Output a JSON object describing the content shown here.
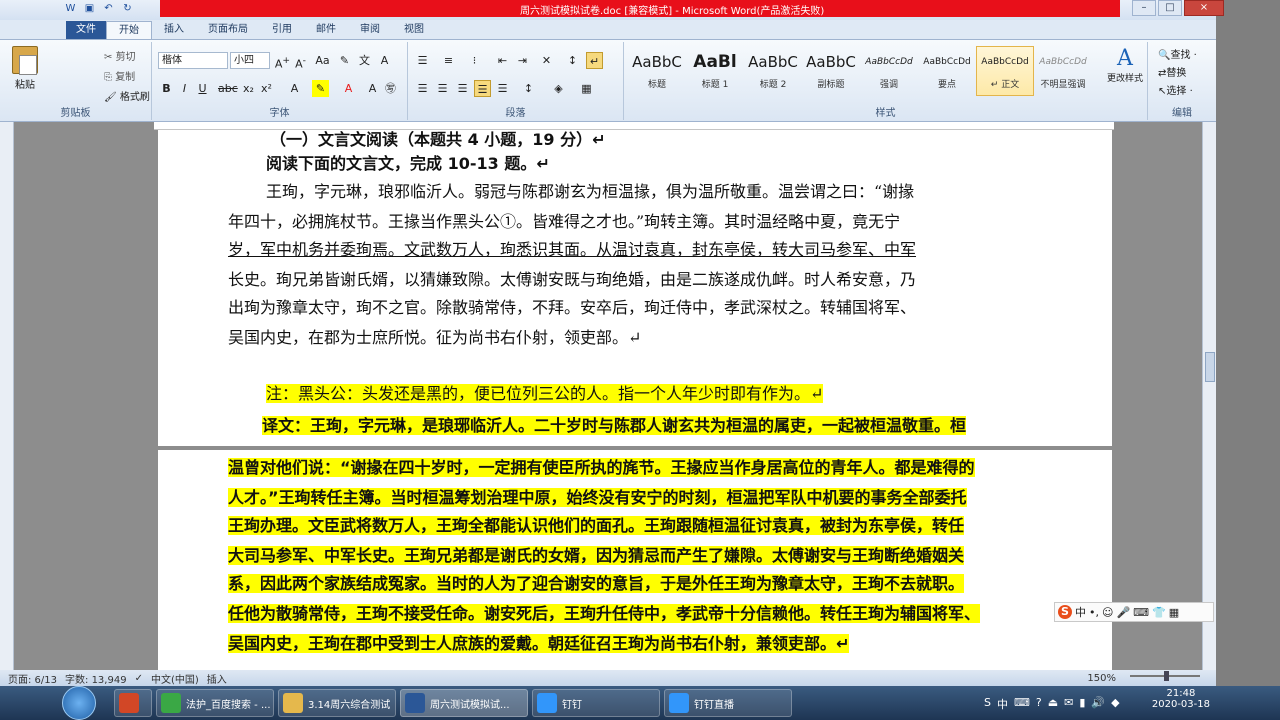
{
  "window": {
    "title": "周六测试模拟试卷.doc [兼容模式] - Microsoft Word(产品激活失败)",
    "min": "–",
    "max": "□",
    "close": "×"
  },
  "tabs": [
    "文件",
    "开始",
    "插入",
    "页面布局",
    "引用",
    "邮件",
    "审阅",
    "视图"
  ],
  "clipboard": {
    "paste": "粘贴",
    "cut": "剪切",
    "copy": "复制",
    "format_painter": "格式刷",
    "label": "剪贴板"
  },
  "font": {
    "name": "楷体",
    "size": "小四",
    "label": "字体"
  },
  "paragraph": {
    "label": "段落"
  },
  "styles": {
    "label": "样式",
    "items": [
      {
        "sample": "AaBbC",
        "name": "标题"
      },
      {
        "sample": "AaBl",
        "name": "标题 1"
      },
      {
        "sample": "AaBbC",
        "name": "标题 2"
      },
      {
        "sample": "AaBbC",
        "name": "副标题"
      },
      {
        "sample": "AaBbCcDd",
        "name": "强调"
      },
      {
        "sample": "AaBbCcDd",
        "name": "要点"
      },
      {
        "sample": "AaBbCcDd",
        "name": "↵ 正文"
      },
      {
        "sample": "AaBbCcDd",
        "name": "不明显强调"
      }
    ],
    "change_styles": "更改样式"
  },
  "editing": {
    "find": "查找 ·",
    "replace": "替换",
    "select": "选择 ·",
    "label": "编辑"
  },
  "document": {
    "heading": "（一）文言文阅读（本题共 4 小题，19 分）↵",
    "instruction": "阅读下面的文言文，完成 10-13 题。↵",
    "p1": "王珣，字元琳，琅邪临沂人。弱冠与陈郡谢玄为桓温掾，俱为温所敬重。温尝谓之曰：“谢掾",
    "p2": "年四十，必拥旄杖节。王掾当作黑头公①。皆难得之才也。”珣转主簿。其时温经略中夏，竟无宁",
    "p3": "岁，军中机务并委珣焉。文武数万人，珣悉识其面。从温讨袁真，封东亭侯，转大司马参军、中军",
    "p4": "长史。珣兄弟皆谢氏婿，以猜嫌致隙。太傅谢安既与珣绝婚，由是二族遂成仇衅。时人希安意，乃",
    "p5": "出珣为豫章太守，珣不之官。除散骑常侍，不拜。安卒后，珣迁侍中，孝武深杖之。转辅国将军、",
    "p6": "吴国内史，在郡为士庶所悦。征为尚书右仆射，领吏部。↵",
    "note": "注：黑头公：头发还是黑的，便已位列三公的人。指一个人年少时即有作为。↵",
    "trans1": "译文：王珣，字元琳，是琅琊临沂人。二十岁时与陈郡人谢玄共为桓温的属吏，一起被桓温敬重。桓",
    "trans2": "温曾对他们说：“谢掾在四十岁时，一定拥有使臣所执的旄节。王掾应当作身居高位的青年人。都是难得的",
    "trans3": "人才。”王珣转任主簿。当时桓温筹划治理中原，始终没有安宁的时刻，桓温把军队中机要的事务全部委托",
    "trans4": "王珣办理。文臣武将数万人，王珣全都能认识他们的面孔。王珣跟随桓温征讨袁真，被封为东亭侯，转任",
    "trans5": "大司马参军、中军长史。王珣兄弟都是谢氏的女婿，因为猜忌而产生了嫌隙。太傅谢安与王珣断绝婚姻关",
    "trans6": "系，因此两个家族结成冤家。当时的人为了迎合谢安的意旨，于是外任王珣为豫章太守，王珣不去就职。",
    "trans7": "任他为散骑常侍，王珣不接受任命。谢安死后，王珣升任侍中，孝武帝十分信赖他。转任王珣为辅国将军、",
    "trans8": "吴国内史，王珣在郡中受到士人庶族的爱戴。朝廷征召王珣为尚书右仆射，兼领吏部。↵"
  },
  "ime": {
    "label": "中"
  },
  "status": {
    "page": "页面: 6/13",
    "words": "字数: 13,949",
    "lang": "中文(中国)",
    "mode": "插入",
    "zoom": "150%"
  },
  "taskbar": {
    "items": [
      "法护_百度搜索 - ...",
      "3.14周六综合测试",
      "周六测试模拟试...",
      "钉钉",
      "钉钉直播"
    ],
    "time": "21:48",
    "date": "2020-03-18"
  },
  "colors": {
    "highlight": "#ffff00",
    "accent_red": "#e81d1d",
    "file_tab": "#2b5797"
  }
}
